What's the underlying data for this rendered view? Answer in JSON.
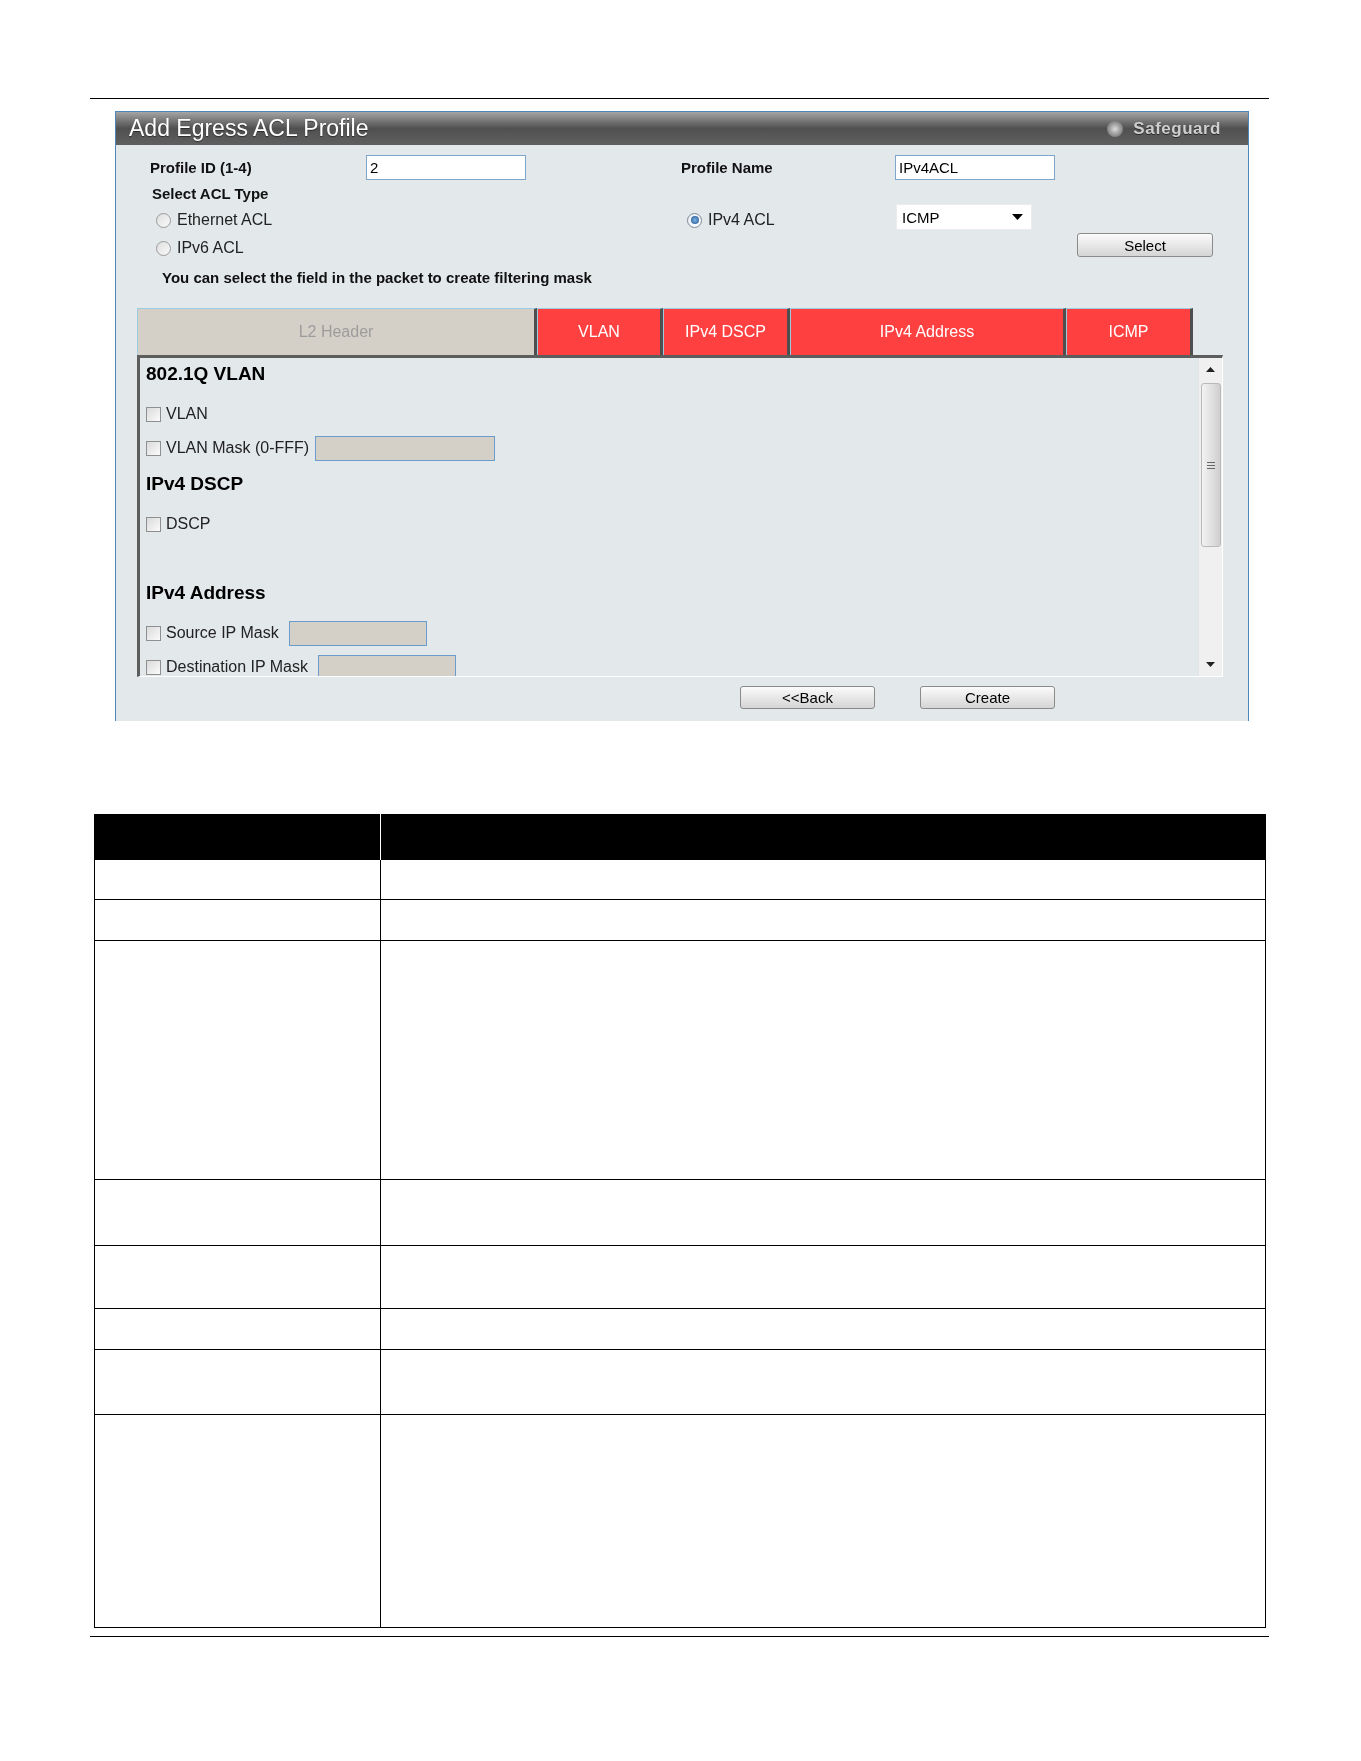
{
  "window": {
    "title": "Add Egress ACL Profile"
  },
  "safeguard": {
    "label": "Safeguard",
    "on": false
  },
  "profile_id": {
    "label": "Profile ID (1-4)",
    "value": "2"
  },
  "profile_name": {
    "label": "Profile Name",
    "value": "IPv4ACL"
  },
  "acl_type": {
    "label": "Select ACL Type",
    "options": [
      {
        "label": "Ethernet ACL",
        "selected": false
      },
      {
        "label": "IPv4 ACL",
        "selected": true
      },
      {
        "label": "IPv6 ACL",
        "selected": false
      }
    ]
  },
  "protocol": {
    "value": "ICMP"
  },
  "select_button": "Select",
  "hint": "You can select the field in the packet to create filtering mask",
  "tabs": [
    {
      "label": "L2 Header",
      "selected": false
    },
    {
      "label": "VLAN",
      "selected": true
    },
    {
      "label": "IPv4 DSCP",
      "selected": true
    },
    {
      "label": "IPv4 Address",
      "selected": true
    },
    {
      "label": "ICMP",
      "selected": true
    }
  ],
  "sections": [
    {
      "title": "802.1Q VLAN",
      "fields": [
        {
          "kind": "plain",
          "label": "VLAN",
          "checked": false
        },
        {
          "kind": "longmask",
          "label": "VLAN Mask (0-FFF)",
          "checked": false,
          "disabled": true
        }
      ]
    },
    {
      "title": "IPv4 DSCP",
      "fields": [
        {
          "kind": "plain",
          "label": "DSCP",
          "checked": false
        }
      ]
    },
    {
      "title": "IPv4 Address",
      "fields": [
        {
          "kind": "mask",
          "label": "Source IP Mask",
          "checked": false,
          "disabled": true
        },
        {
          "kind": "mask",
          "label": "Destination IP Mask",
          "checked": false,
          "disabled": true
        }
      ]
    }
  ],
  "buttons": [
    "<<Back",
    "Create"
  ]
}
